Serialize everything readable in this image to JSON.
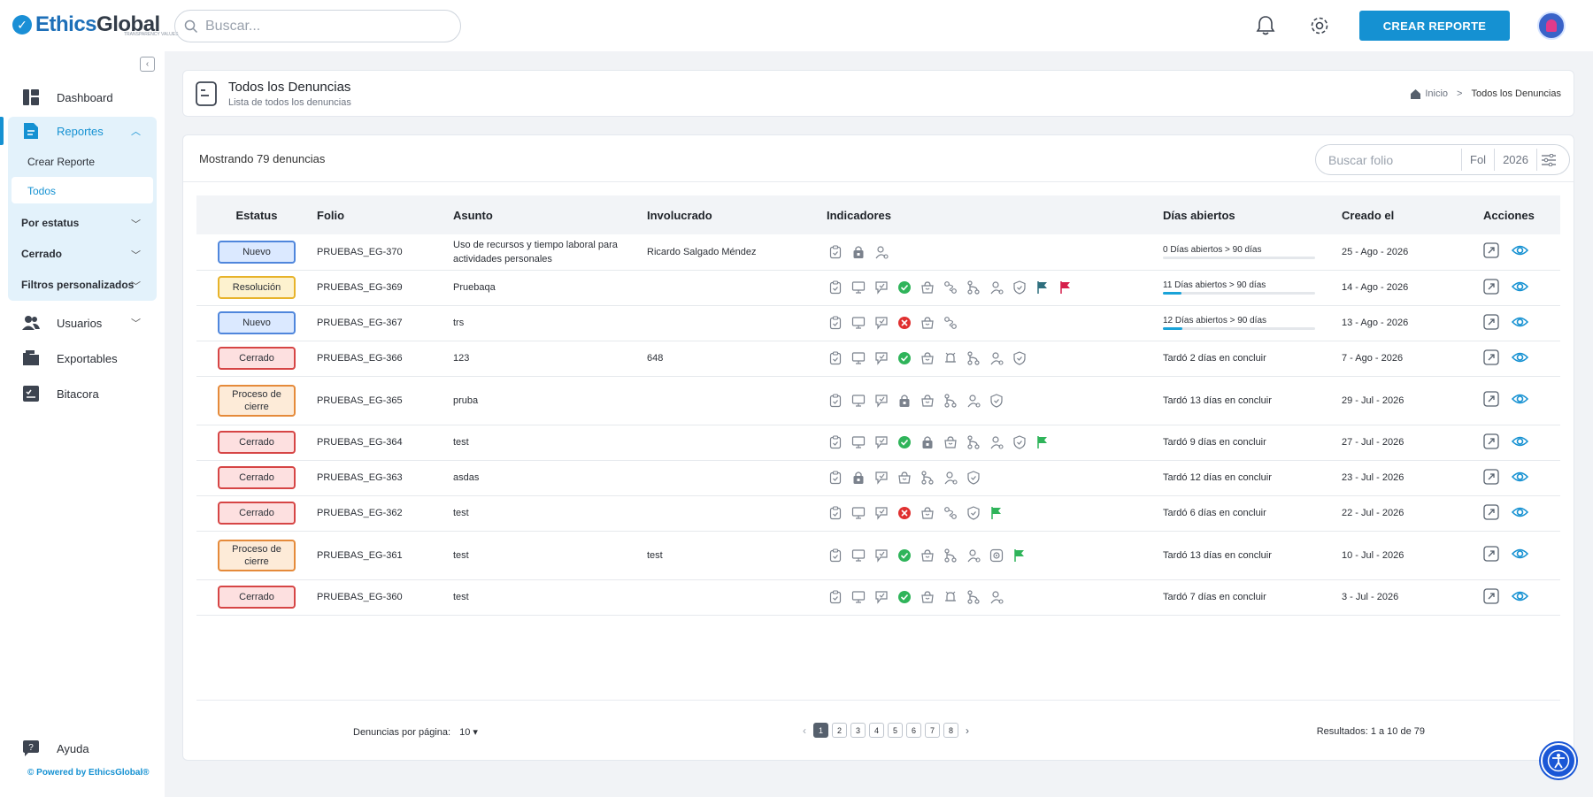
{
  "brand": {
    "name_a": "Ethics",
    "name_b": "Global",
    "tagline": "TRANSPARENCY VALUES"
  },
  "topbar": {
    "search_placeholder": "Buscar...",
    "create_button": "CREAR REPORTE"
  },
  "sidebar": {
    "dashboard": "Dashboard",
    "reportes": "Reportes",
    "crear_reporte": "Crear Reporte",
    "todos": "Todos",
    "por_estatus": "Por estatus",
    "cerrado": "Cerrado",
    "filtros": "Filtros personalizados",
    "usuarios": "Usuarios",
    "exportables": "Exportables",
    "bitacora": "Bitacora",
    "ayuda": "Ayuda",
    "powered": "© Powered by EthicsGlobal®"
  },
  "header": {
    "title": "Todos los Denuncias",
    "subtitle": "Lista de todos los denuncias",
    "crumb_home": "Inicio",
    "crumb_sep": ">",
    "crumb_current": "Todos los Denuncias"
  },
  "list": {
    "showing": "Mostrando 79 denuncias",
    "folio_placeholder": "Buscar folio",
    "filter_fol": "Fol",
    "filter_year": "2026",
    "columns": [
      "Estatus",
      "Folio",
      "Asunto",
      "Involucrado",
      "Indicadores",
      "Días abiertos",
      "Creado el",
      "Acciones"
    ],
    "rows": [
      {
        "status": "Nuevo",
        "kind": "nuevo",
        "folio": "PRUEBAS_EG-370",
        "asunto": "Uso de recursos y tiempo laboral para actividades personales",
        "involucrado": "Ricardo Salgado Méndez",
        "inds": [
          "clip",
          "lock",
          "person"
        ],
        "dias": "0 Días abiertos > 90 días",
        "progress": 0,
        "creado": "25 - Ago - 2026",
        "tall": false
      },
      {
        "status": "Resolución",
        "kind": "resolucion",
        "folio": "PRUEBAS_EG-369",
        "asunto": "Pruebaqa",
        "involucrado": "",
        "inds": [
          "clip",
          "monitor",
          "chat",
          "check",
          "bag",
          "route",
          "branch",
          "person",
          "shield",
          "flag-dark",
          "flag-red"
        ],
        "dias": "11 Días abiertos > 90 días",
        "progress": 12,
        "creado": "14 - Ago - 2026",
        "tall": false
      },
      {
        "status": "Nuevo",
        "kind": "nuevo",
        "folio": "PRUEBAS_EG-367",
        "asunto": "trs",
        "involucrado": "",
        "inds": [
          "clip",
          "monitor",
          "chat",
          "cross",
          "bag",
          "route"
        ],
        "dias": "12 Días abiertos > 90 días",
        "progress": 13,
        "creado": "13 - Ago - 2026",
        "tall": false
      },
      {
        "status": "Cerrado",
        "kind": "cerrado",
        "folio": "PRUEBAS_EG-366",
        "asunto": "123",
        "involucrado": "648",
        "inds": [
          "clip",
          "monitor",
          "chat",
          "check",
          "bag",
          "bell",
          "branch",
          "person",
          "shield"
        ],
        "dias": "Tardó 2 días en concluir",
        "progress": null,
        "creado": "7 - Ago - 2026",
        "tall": false
      },
      {
        "status": "Proceso de cierre",
        "kind": "proceso",
        "folio": "PRUEBAS_EG-365",
        "asunto": "pruba",
        "involucrado": "",
        "inds": [
          "clip",
          "monitor",
          "chat",
          "lock",
          "bag",
          "branch",
          "person",
          "shield"
        ],
        "dias": "Tardó 13 días en concluir",
        "progress": null,
        "creado": "29 - Jul - 2026",
        "tall": true
      },
      {
        "status": "Cerrado",
        "kind": "cerrado",
        "folio": "PRUEBAS_EG-364",
        "asunto": "test",
        "involucrado": "",
        "inds": [
          "clip",
          "monitor",
          "chat",
          "check",
          "lock",
          "bag",
          "branch",
          "person",
          "shield",
          "flag-green"
        ],
        "dias": "Tardó 9 días en concluir",
        "progress": null,
        "creado": "27 - Jul - 2026",
        "tall": false
      },
      {
        "status": "Cerrado",
        "kind": "cerrado",
        "folio": "PRUEBAS_EG-363",
        "asunto": "asdas",
        "involucrado": "",
        "inds": [
          "clip",
          "lock",
          "chat",
          "bag",
          "branch",
          "person",
          "shield"
        ],
        "dias": "Tardó 12 días en concluir",
        "progress": null,
        "creado": "23 - Jul - 2026",
        "tall": false
      },
      {
        "status": "Cerrado",
        "kind": "cerrado",
        "folio": "PRUEBAS_EG-362",
        "asunto": "test",
        "involucrado": "",
        "inds": [
          "clip",
          "monitor",
          "chat",
          "cross",
          "bag",
          "route",
          "shield",
          "flag-green"
        ],
        "dias": "Tardó 6 días en concluir",
        "progress": null,
        "creado": "22 - Jul - 2026",
        "tall": false
      },
      {
        "status": "Proceso de cierre",
        "kind": "proceso",
        "folio": "PRUEBAS_EG-361",
        "asunto": "test",
        "involucrado": "test",
        "inds": [
          "clip",
          "monitor",
          "chat",
          "check",
          "bag",
          "branch",
          "person",
          "gear",
          "flag-green"
        ],
        "dias": "Tardó 13 días en concluir",
        "progress": null,
        "creado": "10 - Jul - 2026",
        "tall": true
      },
      {
        "status": "Cerrado",
        "kind": "cerrado",
        "folio": "PRUEBAS_EG-360",
        "asunto": "test",
        "involucrado": "",
        "inds": [
          "clip",
          "monitor",
          "chat",
          "check",
          "bag",
          "bell",
          "branch",
          "person"
        ],
        "dias": "Tardó 7 días en concluir",
        "progress": null,
        "creado": "3 - Jul - 2026",
        "tall": false
      }
    ]
  },
  "pagination": {
    "per_page_label": "Denuncias por página:",
    "per_page_value": "10",
    "pages": [
      "1",
      "2",
      "3",
      "4",
      "5",
      "6",
      "7",
      "8"
    ],
    "current": "1",
    "prev": "‹",
    "next": "›",
    "results": "Resultados: 1 a 10 de 79"
  },
  "colors": {
    "accent": "#1591d2",
    "nuevo": "#4f86dc",
    "resolucion": "#e7b32a",
    "cerrado": "#d64545",
    "proceso": "#e58a3a",
    "check": "#2fb45a",
    "cross": "#e03030"
  }
}
